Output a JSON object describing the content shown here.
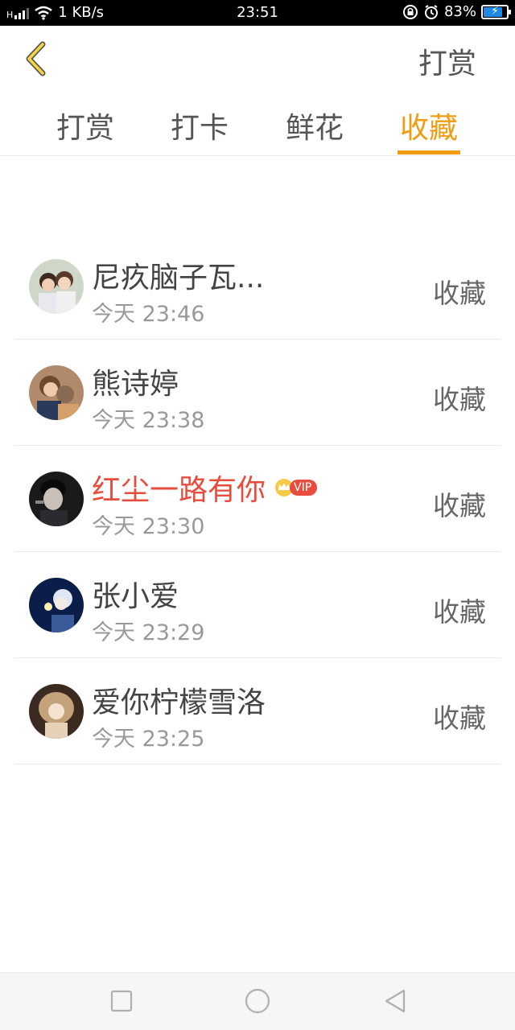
{
  "status_bar": {
    "signal_label": "H",
    "speed": "1 KB/s",
    "time": "23:51",
    "battery_percent": "83%",
    "battery_level": 0.83,
    "icons": [
      "signal-icon",
      "wifi-icon",
      "lock-rotation-icon",
      "alarm-icon",
      "battery-icon"
    ]
  },
  "header": {
    "back_icon": "chevron-left-icon",
    "action_label": "打赏",
    "accent_color": "#f39c12"
  },
  "tabs": [
    {
      "label": "打赏",
      "active": false
    },
    {
      "label": "打卡",
      "active": false
    },
    {
      "label": "鲜花",
      "active": false
    },
    {
      "label": "收藏",
      "active": true
    }
  ],
  "list": [
    {
      "name": "尼疚脑子瓦...",
      "time": "今天 23:46",
      "action": "收藏",
      "vip": false
    },
    {
      "name": "熊诗婷",
      "time": "今天 23:38",
      "action": "收藏",
      "vip": false
    },
    {
      "name": "红尘一路有你",
      "time": "今天 23:30",
      "action": "收藏",
      "vip": true,
      "badge": "VIP"
    },
    {
      "name": "张小爱",
      "time": "今天 23:29",
      "action": "收藏",
      "vip": false
    },
    {
      "name": "爱你柠檬雪洛",
      "time": "今天 23:25",
      "action": "收藏",
      "vip": false
    }
  ],
  "colors": {
    "vip_name": "#e74c3c",
    "text": "#444444",
    "muted": "#999999"
  },
  "nav": {
    "icons": [
      "recent-apps-icon",
      "home-icon",
      "back-icon"
    ]
  }
}
